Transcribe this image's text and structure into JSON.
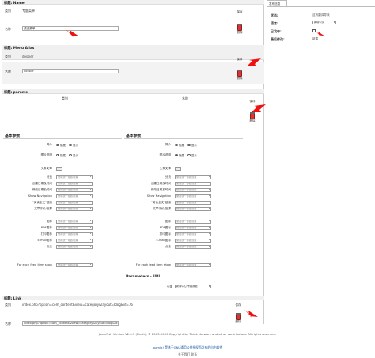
{
  "section_name": {
    "header": "标题: Name",
    "type_label": "类别",
    "type_value": "专题菜单",
    "name_label": "名称",
    "name_value": "频道菜单"
  },
  "section_alias": {
    "header": "标题: Menu Alias",
    "type_label": "类别",
    "type_value": "dossier",
    "name_label": "名称",
    "name_value": "dossier"
  },
  "section_params": {
    "header": "标题: params",
    "col_type": "类别",
    "col_name": "名称"
  },
  "toolbar": {
    "save_label": "保存",
    "delete_label": "删除"
  },
  "left_block": {
    "title": "基本参数",
    "rows": [
      {
        "label": "简介",
        "kind": "radio",
        "opt1": "隐藏",
        "opt2": "显示"
      },
      {
        "label": "图片说明",
        "kind": "radio",
        "opt1": "隐藏",
        "opt2": "显示"
      },
      {
        "label": "头条文章",
        "kind": "mini"
      },
      {
        "label": "分页",
        "kind": "select",
        "value": "使用统一参数设置"
      },
      {
        "label": "创建日期及时间",
        "kind": "select",
        "value": "使用统一参数设置"
      },
      {
        "label": "修改日期及时间",
        "kind": "select",
        "value": "使用统一参数设置"
      },
      {
        "label": "Show Navigation",
        "kind": "select",
        "value": "使用统一参数设置"
      },
      {
        "label": "\"阅读全文\"链接",
        "kind": "select",
        "value": "使用统一参数设置"
      },
      {
        "label": "文章评价/投票",
        "kind": "select",
        "value": "使用统一参数设置"
      },
      {
        "label": "图标",
        "kind": "select",
        "value": "使用统一参数设置"
      },
      {
        "label": "PDF图标",
        "kind": "select",
        "value": "使用统一参数设置"
      },
      {
        "label": "打印图标",
        "kind": "select",
        "value": "使用统一参数设置"
      },
      {
        "label": "E-mail图标",
        "kind": "select",
        "value": "使用统一参数设置"
      },
      {
        "label": "点击",
        "kind": "select",
        "value": "使用统一参数设置"
      },
      {
        "label": "For each feed item show",
        "kind": "select",
        "value": "使用统一参数设置"
      }
    ]
  },
  "right_block": {
    "title": "基本参数",
    "rows": [
      {
        "label": "简介",
        "kind": "radio",
        "opt1": "隐藏",
        "opt2": "显示"
      },
      {
        "label": "图片说明",
        "kind": "radio",
        "opt1": "隐藏",
        "opt2": "显示"
      },
      {
        "label": "头条文章",
        "kind": "mini"
      },
      {
        "label": "分页",
        "kind": "select",
        "value": "使用统一参数设置"
      },
      {
        "label": "创建日期及时间",
        "kind": "select",
        "value": "使用统一参数设置"
      },
      {
        "label": "修改日期及时间",
        "kind": "select",
        "value": "使用统一参数设置"
      },
      {
        "label": "Show Navigation",
        "kind": "select",
        "value": "使用统一参数设置"
      },
      {
        "label": "\"阅读全文\"链接",
        "kind": "select",
        "value": "使用统一参数设置"
      },
      {
        "label": "文章评价/投票",
        "kind": "select",
        "value": "使用统一参数设置"
      },
      {
        "label": "图标",
        "kind": "select",
        "value": "使用统一参数设置"
      },
      {
        "label": "PDF图标",
        "kind": "select",
        "value": "使用统一参数设置"
      },
      {
        "label": "打印图标",
        "kind": "select",
        "value": "使用统一参数设置"
      },
      {
        "label": "E-mail图标",
        "kind": "select",
        "value": "使用统一参数设置"
      },
      {
        "label": "点击",
        "kind": "select",
        "value": "使用统一参数设置"
      },
      {
        "label": "For each feed item show",
        "kind": "select",
        "value": "使用统一参数设置"
      }
    ],
    "params_url_title": "Parameters - URL",
    "url_label": "分类",
    "url_value": "新闻中心/专题报道"
  },
  "section_link": {
    "header": "标题: Link",
    "type_label": "类别",
    "type_value": "index.php?option=com_content&view=category&layout=blog&id=76",
    "name_label": "名称",
    "name_value": "index.php?option=com_content&view=category&layout=blog&id=76"
  },
  "right_panel": {
    "tab": "发布信息",
    "rows": [
      {
        "label": "状态:",
        "value": "这有翻译导读"
      },
      {
        "label": "语言:",
        "value": "新增中文"
      },
      {
        "label": "已发布:",
        "value": ""
      },
      {
        "label": "最后修改:",
        "value": "新建"
      }
    ]
  },
  "footer": {
    "line1": "JoomFish Version V2.0.3 (Flash), © 2003-2009 Copyright by Think Network and other contributors. All rights reserved.",
    "line2": "Joomla! 是基于GNU通用公共授权而发布的自由软件",
    "line3": "关于我们  联系"
  }
}
